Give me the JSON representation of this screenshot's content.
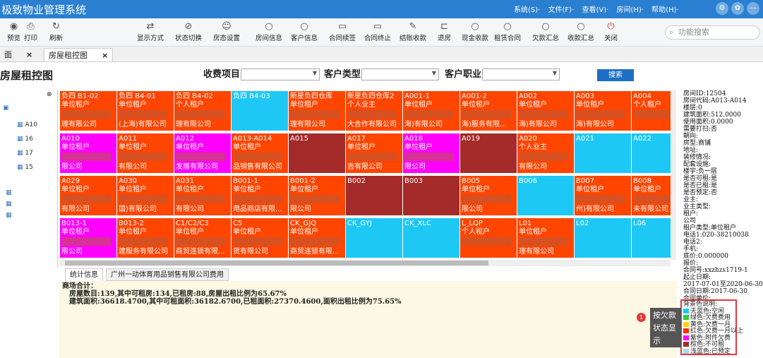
{
  "app": {
    "title": "极致物业管理系统"
  },
  "menu": [
    "系统(S)·",
    "文件(F)·",
    "查看(V)·",
    "房间(H)·",
    "帮助(H)·"
  ],
  "toolbar": [
    {
      "label": "预览",
      "icon": "eye-icon"
    },
    {
      "label": "打印",
      "icon": "print-icon"
    },
    {
      "label": "刷新",
      "icon": "refresh-icon"
    },
    {
      "label": "显示方式",
      "icon": "display-icon"
    },
    {
      "label": "状态切换",
      "icon": "toggle-icon"
    },
    {
      "label": "房态设置",
      "icon": "settings-icon"
    },
    {
      "label": "房间信息",
      "icon": "search-icon"
    },
    {
      "label": "客户信息",
      "icon": "search-icon"
    },
    {
      "label": "合同续签",
      "icon": "document-icon"
    },
    {
      "label": "合同终止",
      "icon": "document-icon"
    },
    {
      "label": "结账收款",
      "icon": "edit-icon"
    },
    {
      "label": "退房",
      "icon": "exit-icon"
    },
    {
      "label": "现金收款",
      "icon": "search-icon"
    },
    {
      "label": "租赁合同",
      "icon": "search-icon"
    },
    {
      "label": "欠款汇总",
      "icon": "search-icon"
    },
    {
      "label": "收款汇总",
      "icon": "search-icon"
    },
    {
      "label": "关闭",
      "icon": "power-icon"
    }
  ],
  "search": {
    "placeholder": "功能搜索"
  },
  "tabs": [
    {
      "label": "面"
    },
    {
      "label": "房屋租控图"
    }
  ],
  "page": {
    "title": "房屋租控图"
  },
  "filters": {
    "charge_item": "收费项目",
    "customer_type": "客户类型",
    "customer_job": "客户职业",
    "search_button": "搜索"
  },
  "tree": {
    "items": [
      "A10",
      "16",
      "17",
      "15"
    ]
  },
  "grid": {
    "rows": [
      [
        {
          "name": "负四 B1-02",
          "type": "单位租户",
          "tenant": "理有限公司",
          "color": "#ff4500"
        },
        {
          "name": "负四 B4-01",
          "type": "单位租户",
          "tenant": "(上海)有限公司",
          "color": "#ff4500"
        },
        {
          "name": "负四 B4-02",
          "type": "个人租户",
          "tenant": "理有限公司",
          "color": "#ff4500"
        },
        {
          "name": "负四 B4-03",
          "type": "",
          "tenant": "",
          "color": "#1ec8f5"
        },
        {
          "name": "新星负四仓库",
          "type": "单位租户",
          "tenant": "理有限公司",
          "color": "#ff4500"
        },
        {
          "name": "新星负四仓库2",
          "type": "个人业主",
          "tenant": "大合作有限公司",
          "color": "#ff4500"
        },
        {
          "name": "A001-1",
          "type": "单位租户",
          "tenant": "海)有限公司",
          "color": "#ff4500"
        },
        {
          "name": "A001-2",
          "type": "单位租户",
          "tenant": "海)服务有限...",
          "color": "#ff4500"
        },
        {
          "name": "A002",
          "type": "单位租户",
          "tenant": "海)有限公司",
          "color": "#ff4500"
        },
        {
          "name": "A003",
          "type": "单位租户",
          "tenant": "海)有限公司",
          "color": "#ff4500"
        },
        {
          "name": "A004",
          "type": "个人租户",
          "tenant": "",
          "color": "#ff4500"
        }
      ],
      [
        {
          "name": "A010",
          "type": "单位租户",
          "tenant": "限公司",
          "color": "#ff00ff"
        },
        {
          "name": "A011",
          "type": "单位租户",
          "tenant": "有限公司",
          "color": "#ff4500"
        },
        {
          "name": "A012",
          "type": "单位租户",
          "tenant": "发展有限公司",
          "color": "#ff00ff"
        },
        {
          "name": "A013-A014",
          "type": "单位租户",
          "tenant": "品销售有限公司",
          "color": "#ff4500"
        },
        {
          "name": "A015",
          "type": "",
          "tenant": "",
          "color": "#a52a2a"
        },
        {
          "name": "A017",
          "type": "单位租户",
          "tenant": "吉有限公司",
          "color": "#ff4500"
        },
        {
          "name": "A018",
          "type": "单位租户",
          "tenant": "限公司",
          "color": "#ff00ff"
        },
        {
          "name": "A019",
          "type": "",
          "tenant": "",
          "color": "#a52a2a"
        },
        {
          "name": "A020",
          "type": "个人业主",
          "tenant": "有限公司",
          "color": "#ff4500"
        },
        {
          "name": "A021",
          "type": "",
          "tenant": "",
          "color": "#1ec8f5"
        },
        {
          "name": "A022",
          "type": "",
          "tenant": "",
          "color": "#1ec8f5"
        }
      ],
      [
        {
          "name": "A029",
          "type": "单位租户",
          "tenant": "有限公司",
          "color": "#ff4500"
        },
        {
          "name": "A030",
          "type": "单位租户",
          "tenant": "国)有限公司",
          "color": "#ff4500"
        },
        {
          "name": "A031",
          "type": "单位租户",
          "tenant": "有限公司",
          "color": "#ff4500"
        },
        {
          "name": "B001-1",
          "type": "单位租户",
          "tenant": "用品商店有限...",
          "color": "#ff4500"
        },
        {
          "name": "B001-2",
          "type": "单位租户",
          "tenant": "限公司",
          "color": "#ff4500"
        },
        {
          "name": "B002",
          "type": "",
          "tenant": "",
          "color": "#a52a2a"
        },
        {
          "name": "B003",
          "type": "",
          "tenant": "",
          "color": "#a52a2a"
        },
        {
          "name": "B005",
          "type": "单位租户",
          "tenant": "限公司",
          "color": "#ff4500"
        },
        {
          "name": "B006",
          "type": "",
          "tenant": "",
          "color": "#1ec8f5"
        },
        {
          "name": "B007",
          "type": "单位租户",
          "tenant": "州)有限公司",
          "color": "#ff4500"
        },
        {
          "name": "B008",
          "type": "单位租户",
          "tenant": "未有限公司",
          "color": "#ff4500"
        }
      ],
      [
        {
          "name": "B013-1",
          "type": "单位租户",
          "tenant": "限公司",
          "color": "#ff00ff"
        },
        {
          "name": "B013-2",
          "type": "单位租户",
          "tenant": "建服务有限公司",
          "color": "#ff4500"
        },
        {
          "name": "C1/C2/C3",
          "type": "单位租户",
          "tenant": "商贸连锁有限...",
          "color": "#ff4500"
        },
        {
          "name": "C5",
          "type": "单位租户",
          "tenant": "货有限公司",
          "color": "#ff4500"
        },
        {
          "name": "CK_GJQ",
          "type": "单位租户",
          "tenant": "商贸连锁有限...",
          "color": "#ff4500"
        },
        {
          "name": "CK_GYJ",
          "type": "",
          "tenant": "",
          "color": "#1ec8f5"
        },
        {
          "name": "CK_XLC",
          "type": "",
          "tenant": "",
          "color": "#1ec8f5"
        },
        {
          "name": "L_LQP",
          "type": "个人租户",
          "tenant": "",
          "color": "#ff4500"
        },
        {
          "name": "L01",
          "type": "单位租户",
          "tenant": "理有限公司",
          "color": "#ff4500"
        },
        {
          "name": "L02",
          "type": "",
          "tenant": "",
          "color": "#1ec8f5"
        },
        {
          "name": "L06",
          "type": "",
          "tenant": "",
          "color": "#1ec8f5"
        }
      ]
    ]
  },
  "bottom_tabs": [
    {
      "label": "统计信息"
    },
    {
      "label": "广州一动体育用品销售有限公司费用"
    }
  ],
  "stats": {
    "line1": "商场合计：",
    "line2": "房屋数目:139,其中可租房:134,已租房:88,房屋出租比例为65.67%",
    "line3": "建筑面积:36618.4700,其中可租面积:36182.6700,已租面积:27370.4600,面积出租比例为75.65%"
  },
  "info": [
    "房间ID:12504",
    "房间代码:A013-A014",
    "楼层:0",
    "建筑面积:512.0000",
    "使用面积:0.0000",
    "需要打扫:否",
    "朝向:",
    "房型:商铺",
    "地址:",
    "装修情况:",
    "配套设施:",
    "楼宇:负一层",
    "是否可租:是",
    "是否已租:是",
    "是否预定:否",
    "业主:",
    "业主类型:",
    "租户:",
    "公司",
    "租户类型:单位租户",
    "电话1:020-38210038",
    "电话2:",
    "手机:",
    "底价:0.000000",
    "报价:",
    "合同号:xxzhzs1719-1",
    "起止日期:",
    "2017-07-01至2020-06-30",
    "合同日期:2017-06-30",
    "合同单价:"
  ],
  "legend": {
    "title": "背景色说明:",
    "items": [
      {
        "label": "天蓝色:空闲",
        "color": "#1ec8f5"
      },
      {
        "label": "绿色:欠费费用",
        "color": "#33cc33"
      },
      {
        "label": "黄色:欠费一月",
        "color": "#ffd400"
      },
      {
        "label": "红色:欠费一月以上",
        "color": "#ff2a00"
      },
      {
        "label": "紫色:附件欠费",
        "color": "#ff00ff"
      },
      {
        "label": "棕色:不可租",
        "color": "#a52a2a"
      },
      {
        "label": "浅蓝色:已预定",
        "color": "#b0d4f0"
      }
    ]
  },
  "tooltip": {
    "text": "按欠款状态显示",
    "badge": "1"
  }
}
